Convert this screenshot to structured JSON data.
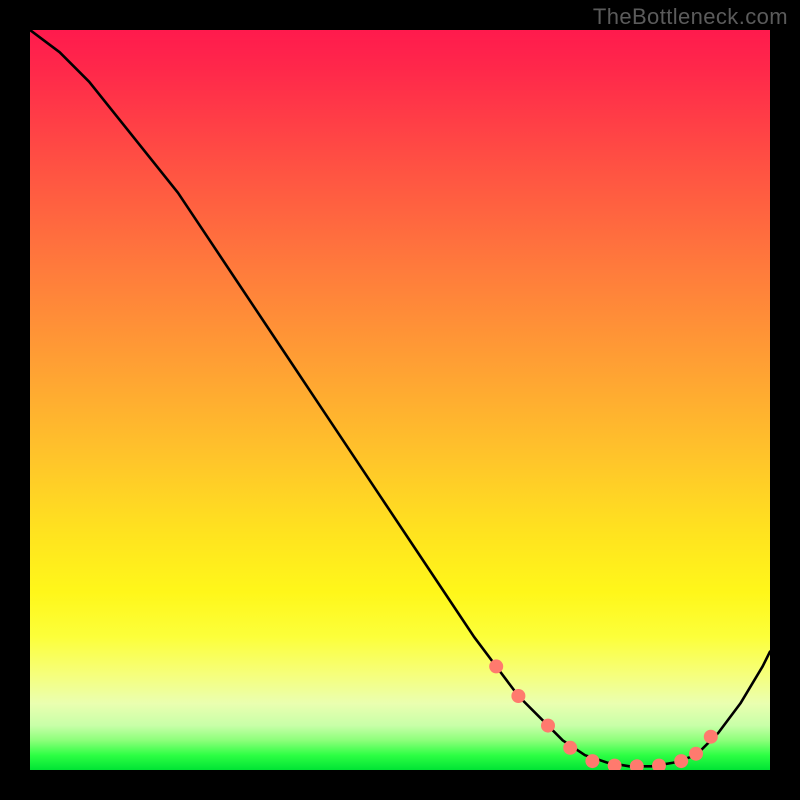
{
  "watermark": "TheBottleneck.com",
  "chart_data": {
    "type": "line",
    "title": "",
    "xlabel": "",
    "ylabel": "",
    "xlim": [
      0,
      100
    ],
    "ylim": [
      0,
      100
    ],
    "series": [
      {
        "name": "bottleneck-curve",
        "x": [
          0,
          4,
          8,
          12,
          16,
          20,
          24,
          28,
          32,
          36,
          40,
          44,
          48,
          52,
          56,
          60,
          63,
          66,
          69,
          72,
          75,
          78,
          81,
          84,
          87,
          90,
          93,
          96,
          99,
          100
        ],
        "y": [
          100,
          97,
          93,
          88,
          83,
          78,
          72,
          66,
          60,
          54,
          48,
          42,
          36,
          30,
          24,
          18,
          14,
          10,
          7,
          4,
          2,
          1,
          0.5,
          0.5,
          1,
          2,
          5,
          9,
          14,
          16
        ]
      }
    ],
    "markers": {
      "name": "highlight-dots",
      "x": [
        63,
        66,
        70,
        73,
        76,
        79,
        82,
        85,
        88,
        90,
        92
      ],
      "y": [
        14,
        10,
        6,
        3,
        1.2,
        0.6,
        0.5,
        0.6,
        1.2,
        2.2,
        4.5
      ]
    }
  },
  "colors": {
    "curve": "#000000",
    "dots": "#ff7a6e",
    "background": "#000000"
  }
}
